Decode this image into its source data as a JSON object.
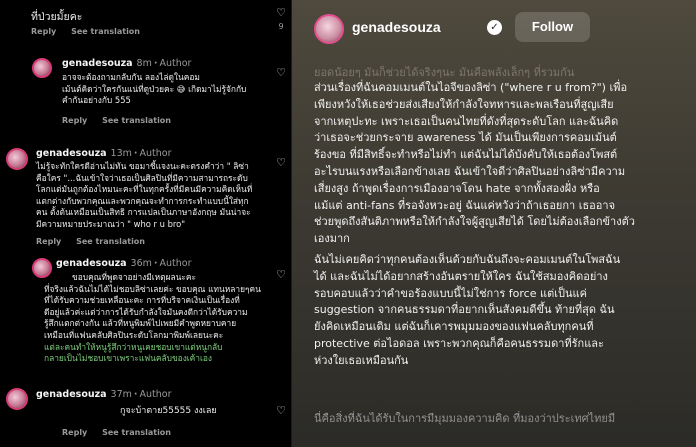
{
  "left_panel": {
    "top_comment": {
      "text": "ที่ป่วยมั้ยคะ",
      "reply_label": "Reply",
      "translation_label": "See translation",
      "like_count": "9"
    },
    "comments": [
      {
        "author": "genadesouza",
        "ago": "8m",
        "tag": "Author",
        "lines": [
          "อาจจะต้องถามกลับกัน ลองไล่ดูในคอม",
          "เม้นต์คิดว่าใครกันแน่ที่ดูป่วยคะ 😅 เกิดมาไม่รู้จักกับ",
          "คำกันอย่างกับ 555"
        ],
        "reply_label": "Reply",
        "translation_label": "See translation"
      },
      {
        "author": "genadesouza",
        "ago": "13m",
        "tag": "Author",
        "lines": [
          "ไม่รู้จะทักใครดีอ่านไม่ทัน ขอมาชี้แจงนะคะตรงคำว่า \" ลิซ่า",
          "คือใคร \"...ฉันเข้าใจว่าเธอเป็นศิลปินที่มีความสามารถระดับ",
          "โลกแต่มันถูกต้องไหมนะคะที่ในทุกครั้งที่มีคนมีความคิดเห็นที่",
          "แตกต่างกับพวกคุณและพวกคุณจะทำการกระทำแบบนี้ใส่ทุก",
          "คน ตั้งต้นเหมือนเป็นสิทธิ การแปลเป็นภาษาอังกฤษ มันน่าจะ",
          "มีความหมายประมาณว่า \" who r u bro\""
        ],
        "reply_label": "Reply",
        "translation_label": "See translation"
      },
      {
        "author": "genadesouza",
        "ago": "36m",
        "tag": "Author",
        "lines": [
          "ขอบคุณที่พูดจาอย่างมีเหตุผลนะคะ",
          "ที่จริงแล้วฉันไม่ได้ไม่ชอบลิซ่าเลยค่ะ ขอบคุณ แทนหลายๆคน",
          "ที่ได้รับความช่วยเหลือนะคะ การที่บริจาคเงินเป็นเรื่องที่",
          "ดีอยู่แล้วค่ะแต่ว่าการได้รับกำลังใจมันคงดีกว่าได้รับความ",
          "รู้สึกแตกต่างกัน แล้วที่หนูพิมพ์ไปเพยมีคำพูดหยาบคาย",
          "เหมือนที่แฟนคลับศิลปินระดับโลกมาพิมพ์เลยนะคะ"
        ],
        "highlight_lines": [
          "แต่ละคนทำให้หนูรู้สึกว่าหนูเคยชอบเขาแต่หนูกลับ",
          "กลายเป็นไม่ชอบเขาเพราะแฟนคลับของเค้าเอง"
        ],
        "reply_label": "Reply",
        "translation_label": "See translation"
      },
      {
        "author": "genadesouza",
        "ago": "37m",
        "tag": "Author",
        "lines": [
          "กูจะบ้าตาย55555 งงเลย"
        ],
        "reply_label": "Reply",
        "translation_label": "See translation"
      }
    ]
  },
  "right_panel": {
    "username": "genadesouza",
    "verified_mark": "✓",
    "follow_label": "Follow",
    "faded_line": "ยอดน้อยๆ มันก็ช่วยได้จริงๆนะ มันคือพลังเล็กๆ ที่รวมกัน",
    "caption_p1": "ส่วนเรื่องที่ฉันคอมเมนต์ในไอจีของลิซ่า (\"where r u from?\") เพื่อ\nเพียงหวังให้เธอช่วยส่งเสียงให้กำลังใจทหารและพลเรือนที่สูญเสีย\nจากเหตุปะทะ เพราะเธอเป็นคนไทยที่ดังที่สุดระดับโลก และฉันคิด\nว่าเธอจะช่วยกระจาย awareness ได้ มันเป็นเพียงการคอมเม้นต์\nร้องขอ ที่มีสิทธิ์จะทำหรือไม่ทำ แต่ฉันไม่ได้บังคับให้เธอต้องโพสต์\nอะไรบนแรงหรือเลือกข้างเลย ฉันเข้าใจดีว่าศิลปินอย่างลิซ่ามีความ\nเสี่ยงสูง ถ้าพูดเรื่องการเมืองอาจโดน hate จากทั้งสองฝั่ง หรือ\nแม้แต่ anti-fans ที่รอจังหวะอยู่ ฉันแค่หวังว่าถ้าเธอยกา เธออาจ\nช่วยพูดถึงสันติภาพหรือให้กำลังใจผู้สูญเสียได้ โดยไม่ต้องเลือกข้างตัว\nเองมาก",
    "caption_p2": "ฉันไม่เคยคิดว่าทุกคนต้องเห็นด้วยกับฉันถึงจะคอมเมนต์ในโพสฉัน\nได้ และฉันไม่ได้อยากสร้างอันตรายให้ใคร ฉันใช้สมองคิดอย่าง\nรอบคอบแล้วว่าคำขอร้องแบบนี้ไม่ใช่การ force แต่เป็นแค่\nsuggestion จากคนธรรมดาที่อยากเห็นสังคมดีขึ้น ท้ายที่สุด ฉัน\nยังคิดเหมือนเดิม แต่ฉันก็เคารพมุมมองของแฟนคลับทุกคนที่\nprotective ต่อไอดอล เพราะพวกคุณก็คือคนธรรมดาที่รักและ\nห่วงใยเธอเหมือนกัน",
    "dim_line": "นี่คือสิ่งที่ฉันได้รับในการมีมุมมองความคิด ที่มองว่าประเทศไทยมี"
  }
}
